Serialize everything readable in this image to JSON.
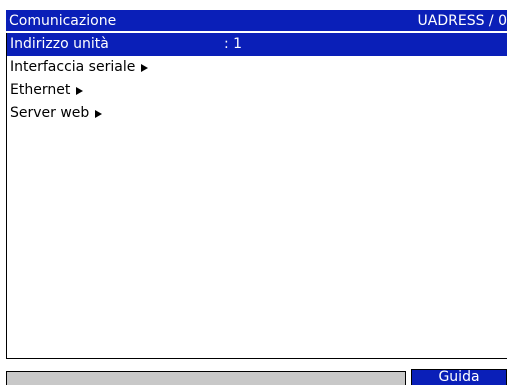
{
  "header": {
    "title": "Comunicazione",
    "code": "UADRESS / 0"
  },
  "menu": {
    "items": [
      {
        "label": "Indirizzo unità",
        "value": ": 1",
        "selected": true,
        "submenu": false
      },
      {
        "label": "Interfaccia seriale",
        "submenu": true
      },
      {
        "label": "Ethernet",
        "submenu": true
      },
      {
        "label": "Server web",
        "submenu": true
      }
    ]
  },
  "footer": {
    "status_text": "",
    "help_label": "Guida"
  },
  "colors": {
    "highlight": "#0a1fb8",
    "status_field": "#c8c8c8",
    "background": "#ffffff"
  },
  "icons": {
    "submenu": "triangle-right-icon"
  }
}
